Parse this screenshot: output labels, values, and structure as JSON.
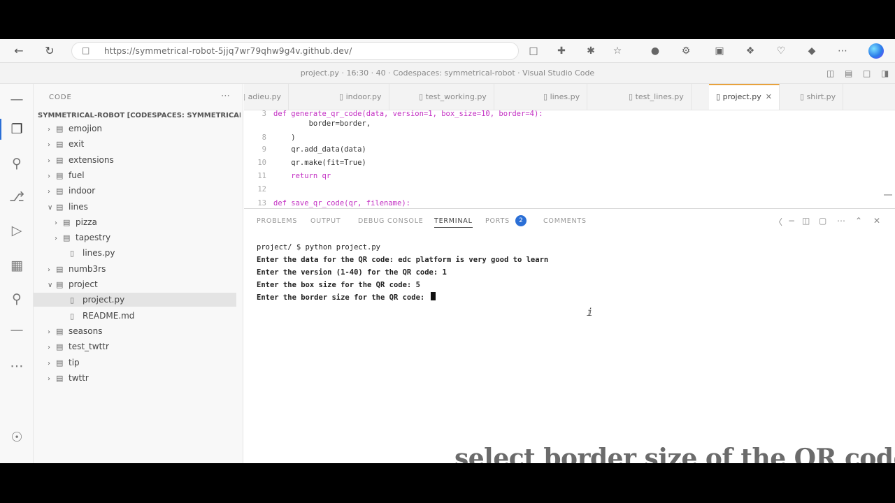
{
  "browser": {
    "url": "https://symmetrical-robot-5jjq7wr79qhw9g4v.github.dev/",
    "icons": [
      "back-icon",
      "refresh-icon",
      "lock-icon",
      "tab-icon",
      "favorite-add-icon",
      "extensions-icon",
      "star-icon",
      "puzzle-icon",
      "settings-icon",
      "split-icon",
      "collections-icon",
      "browser-essentials-icon",
      "shield-icon",
      "more-icon",
      "copilot-icon"
    ]
  },
  "window": {
    "title": "project.py · 16:30 · 40 · Codespaces: symmetrical-robot · Visual Studio Code"
  },
  "sidebar": {
    "title": "CODE",
    "root": "SYMMETRICAL-ROBOT [CODESPACES: SYMMETRICAL-ROBOT]",
    "items": [
      {
        "label": "emojion",
        "type": "folder",
        "expanded": false
      },
      {
        "label": "exit",
        "type": "folder",
        "expanded": false
      },
      {
        "label": "extensions",
        "type": "folder",
        "expanded": false
      },
      {
        "label": "fuel",
        "type": "folder",
        "expanded": false
      },
      {
        "label": "indoor",
        "type": "folder",
        "expanded": false
      },
      {
        "label": "lines",
        "type": "folder",
        "expanded": true
      },
      {
        "label": "pizza",
        "type": "folder",
        "expanded": false
      },
      {
        "label": "tapestry",
        "type": "folder",
        "expanded": false
      },
      {
        "label": "lines.py",
        "type": "file"
      },
      {
        "label": "numb3rs",
        "type": "folder",
        "expanded": false
      },
      {
        "label": "project",
        "type": "folder",
        "expanded": true
      },
      {
        "label": "project.py",
        "type": "file",
        "selected": true
      },
      {
        "label": "README.md",
        "type": "file"
      },
      {
        "label": "seasons",
        "type": "folder",
        "expanded": false
      },
      {
        "label": "test_twttr",
        "type": "folder",
        "expanded": false
      },
      {
        "label": "tip",
        "type": "folder",
        "expanded": false
      },
      {
        "label": "twttr",
        "type": "folder",
        "expanded": false
      }
    ]
  },
  "tabs": [
    {
      "label": "adieu.py"
    },
    {
      "label": "indoor.py"
    },
    {
      "label": "test_working.py"
    },
    {
      "label": "lines.py"
    },
    {
      "label": "test_lines.py"
    },
    {
      "label": "project.py",
      "active": true
    },
    {
      "label": "shirt.py"
    }
  ],
  "editor": {
    "lines": [
      {
        "n": "3",
        "text": "def generate_qr_code(data, version=1, box_size=10, border=4):"
      },
      {
        "n": "",
        "text": "        border=border,"
      },
      {
        "n": "8",
        "text": "    )"
      },
      {
        "n": "9",
        "text": "    qr.add_data(data)"
      },
      {
        "n": "10",
        "text": "    qr.make(fit=True)"
      },
      {
        "n": "11",
        "text": "    return qr"
      },
      {
        "n": "12",
        "text": ""
      },
      {
        "n": "13",
        "text": "def save_qr_code(qr, filename):"
      }
    ]
  },
  "panel": {
    "tabs": [
      "PROBLEMS",
      "OUTPUT",
      "DEBUG CONSOLE",
      "TERMINAL",
      "PORTS",
      "COMMENTS"
    ],
    "active_tab": "TERMINAL",
    "ports_badge": "2",
    "terminal": [
      "project/ $ python project.py",
      "Enter the data for the QR code: edc platform is very good to learn",
      "Enter the version (1-40) for the QR code: 1",
      "Enter the box size for the QR code: 5",
      "Enter the border size for the QR code: "
    ]
  },
  "caption": "select border size of the QR code"
}
